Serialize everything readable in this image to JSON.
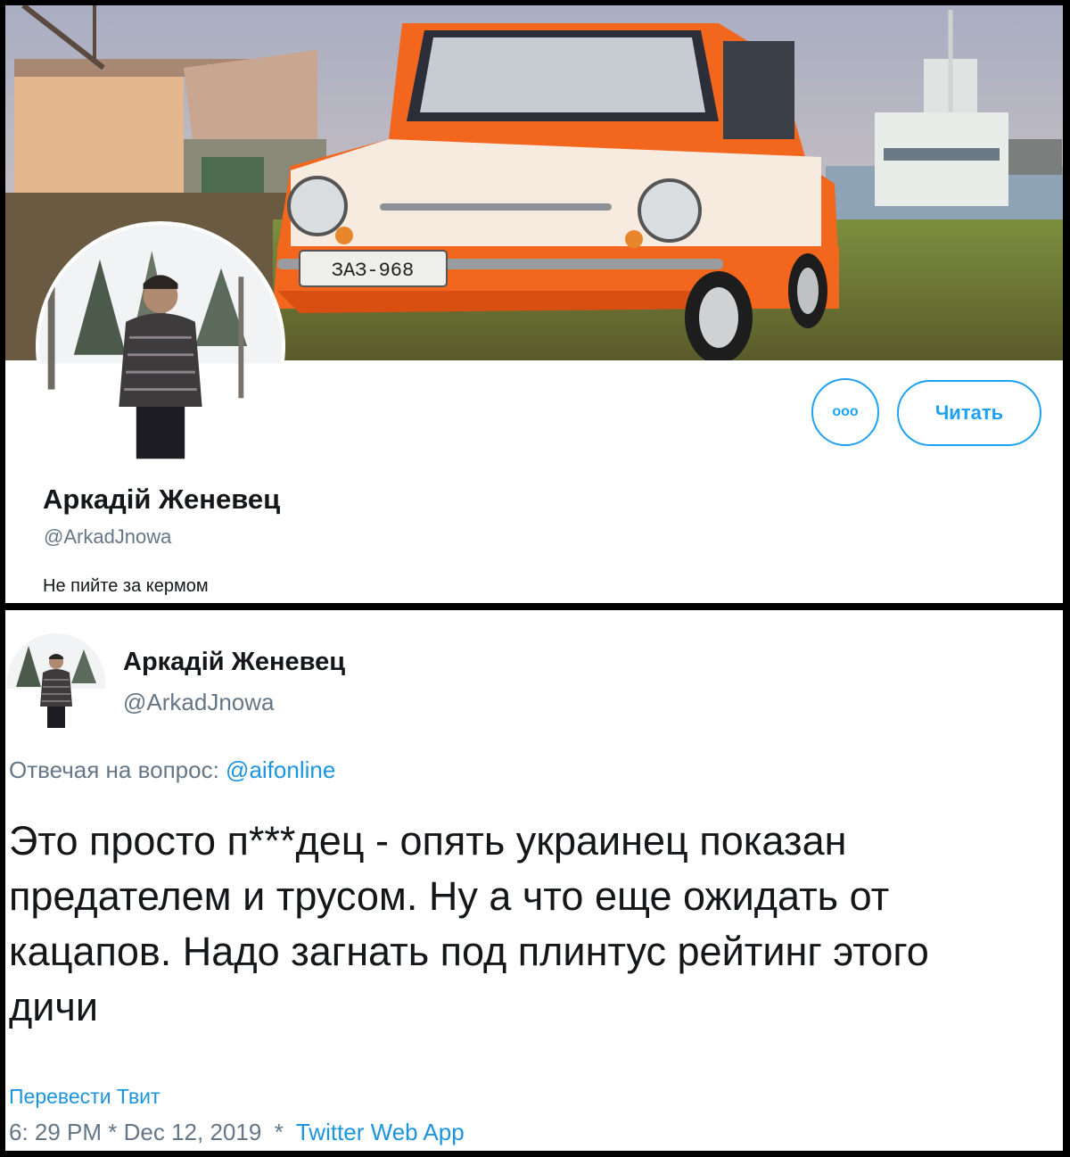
{
  "profile": {
    "banner_plate": "ЗАЗ-968",
    "more_label": "ooo",
    "follow_label": "Читать",
    "name": "Аркадій Женевец",
    "handle": "@ArkadJnowa",
    "bio": "Не пийте за кермом"
  },
  "tweet": {
    "name": "Аркадій Женевец",
    "handle": "@ArkadJnowa",
    "reply_prefix": "Отвечая на вопрос:",
    "reply_mention": "@aifonline",
    "text": "Это просто п***дец - опять украинец показан\nпредателем и трусом.  Ну а что еще ожидать от\nкацапов.  Надо загнать под плинтус рейтинг этого\nдичи",
    "translate_label": "Перевести Твит",
    "time": "6: 29 PM",
    "sep1": " * ",
    "date": "Dec 12, 2019",
    "sep2": "  *  ",
    "source": "Twitter Web App"
  },
  "colors": {
    "accent": "#1da1f2",
    "link": "#1b95e0",
    "secondary_text": "#657786",
    "primary_text": "#14171a",
    "car_orange": "#f2661e"
  }
}
